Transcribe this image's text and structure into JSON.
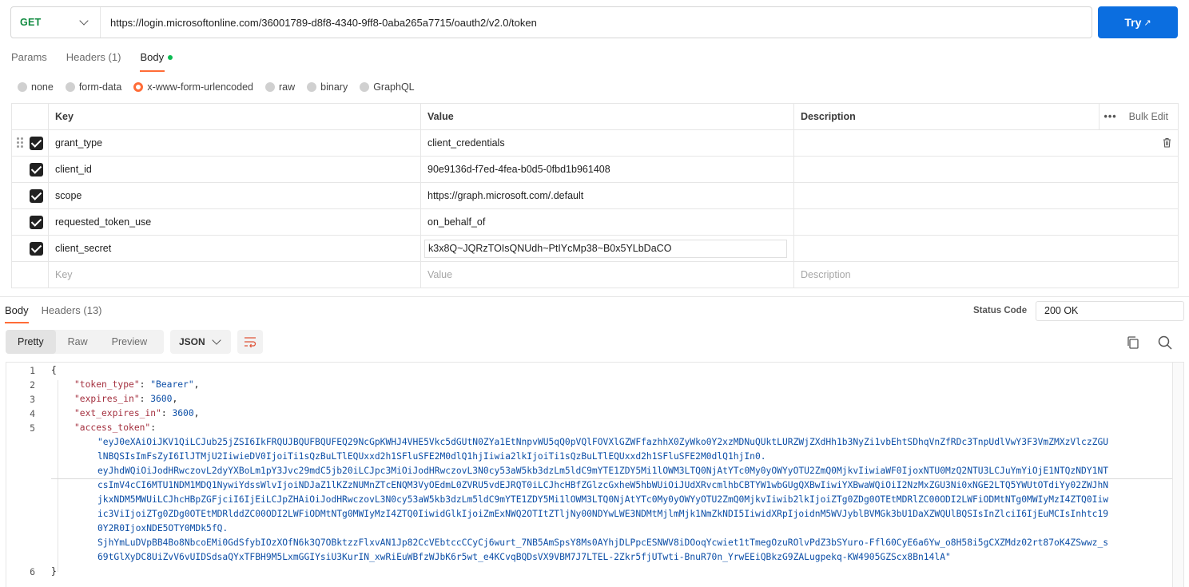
{
  "request": {
    "method": "GET",
    "url": "https://login.microsoftonline.com/36001789-d8f8-4340-9ff8-0aba265a7715/oauth2/v2.0/token",
    "try_label": "Try",
    "try_icon": "external-arrow-icon"
  },
  "request_tabs": [
    {
      "label": "Params"
    },
    {
      "label": "Headers (1)"
    },
    {
      "label": "Body"
    }
  ],
  "body_types": [
    "none",
    "form-data",
    "x-www-form-urlencoded",
    "raw",
    "binary",
    "GraphQL"
  ],
  "body_type_selected": "x-www-form-urlencoded",
  "table": {
    "headers": {
      "key": "Key",
      "value": "Value",
      "description": "Description",
      "bulk_edit": "Bulk Edit"
    },
    "rows": [
      {
        "key": "grant_type",
        "value": "client_credentials",
        "checked": true
      },
      {
        "key": "client_id",
        "value": "90e9136d-f7ed-4fea-b0d5-0fbd1b961408",
        "checked": true
      },
      {
        "key": "scope",
        "value": "https://graph.microsoft.com/.default",
        "checked": true
      },
      {
        "key": "requested_token_use",
        "value": "on_behalf_of",
        "checked": true
      },
      {
        "key": "client_secret",
        "value": "k3x8Q~JQRzTOIsQNUdh~PtIYcMp38~B0x5YLbDaCO",
        "checked": true
      }
    ],
    "placeholders": {
      "key": "Key",
      "value": "Value",
      "description": "Description"
    }
  },
  "response": {
    "tabs": [
      {
        "label": "Body"
      },
      {
        "label": "Headers (13)"
      }
    ],
    "status_label": "Status Code",
    "status_value": "200 OK",
    "views": [
      "Pretty",
      "Raw",
      "Preview"
    ],
    "format": "JSON",
    "lines": {
      "l1": "{",
      "l6": "}",
      "token_type_key": "\"token_type\"",
      "token_type_val": "\"Bearer\"",
      "expires_in_key": "\"expires_in\"",
      "expires_in_val": "3600",
      "ext_expires_in_key": "\"ext_expires_in\"",
      "ext_expires_in_val": "3600",
      "access_token_key": "\"access_token\"",
      "access_token_lines": [
        "\"eyJ0eXAiOiJKV1QiLCJub25jZSI6IkFRQUJBQUFBQUFEQ29NcGpKWHJ4VHE5Vkc5dGUtN0ZYa1EtNnpvWU5qQ0pVQlFOVXlGZWFfazhhX0ZyWko0Y2xzMDNuQUktLURZWjZXdHh1b3NyZi1vbEhtSDhqVnZfRDc3TnpUdlVwY3F3VmZMXzVlczZGU",
        "lNBQSIsImFsZyI6IlJTMjU2IiwieDV0IjoiTi1sQzBuLTlEQUxxd2h1SFluSFE2M0dlQ1hjIiwia2lkIjoiTi1sQzBuLTlEQUxxd2h1SFluSFE2M0dlQ1hjIn0.",
        "eyJhdWQiOiJodHRwczovL2dyYXBoLm1pY3Jvc29mdC5jb20iLCJpc3MiOiJodHRwczovL3N0cy53aW5kb3dzLm5ldC9mYTE1ZDY5Mi1lOWM3LTQ0NjAtYTc0My0yOWYyOTU2ZmQ0MjkvIiwiaWF0IjoxNTU0MzQ2NTU3LCJuYmYiOjE1NTQzNDY1NT",
        "csImV4cCI6MTU1NDM1MDQ1NywiYdssWlvIjoiNDJaZ1lKZzNUMnZTcENQM3VyOEdmL0ZVRU5vdEJRQT0iLCJhcHBfZGlzcGxheW5hbWUiOiJUdXRvcmlhbCBTYW1wbGUgQXBwIiwiYXBwaWQiOiI2NzMxZGU3Ni0xNGE2LTQ5YWUtOTdiYy02ZWJhN",
        "jkxNDM5MWUiLCJhcHBpZGFjciI6IjEiLCJpZHAiOiJodHRwczovL3N0cy53aW5kb3dzLm5ldC9mYTE1ZDY5Mi1lOWM3LTQ0NjAtYTc0My0yOWYyOTU2ZmQ0MjkvIiwib2lkIjoiZTg0ZDg0OTEtMDRlZC00ODI2LWFiODMtNTg0MWIyMzI4ZTQ0Iiw",
        "ic3ViIjoiZTg0ZDg0OTEtMDRlddZC00ODI2LWFiODMtNTg0MWIyMzI4ZTQ0IiwidGlkIjoiZmExNWQ2OTItZTljNy00NDYwLWE3NDMtMjlmMjk1NmZkNDI5IiwidXRpIjoidnM5WVJyblBVMGk3bU1DaXZWQUlBQSIsInZlciI6IjEuMCIsInhtc19",
        "0Y2R0IjoxNDE5OTY0MDk5fQ.",
        "SjhYmLuDVpBB4Bo8NbcoEMi0GdSfybIOzXOfN6k3Q7OBktzzFlxvAN1Jp82CcVEbtccCCyCj6wurt_7NB5AmSpsY8Ms0AYhjDLPpcESNWV8iDOoqYcwiet1tTmegOzuROlvPdZ3bSYuro-Ffl60CyE6a6Yw_o8H58i5gCXZMdz02rt87oK4ZSwwz_s",
        "69tGlXyDC8UiZvV6vUIDSdsaQYxTFBH9M5LxmGGIYsiU3KurIN_xwRiEuWBfzWJbK6r5wt_e4KCvqBQDsVX9VBM7J7LTEL-2Zkr5fjUTwti-BnuR70n_YrwEEiQBkzG9ZALugpekq-KW4905GZScx8Bn14lA\""
      ]
    }
  }
}
